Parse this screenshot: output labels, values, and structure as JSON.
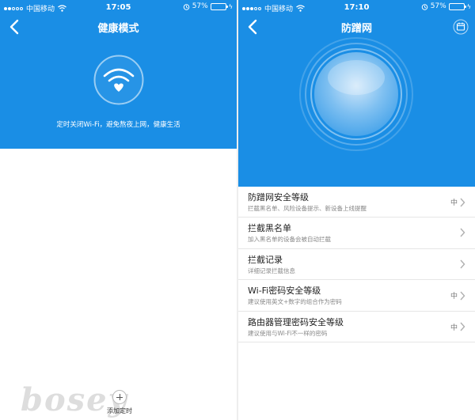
{
  "left": {
    "status": {
      "carrier": "中国移动",
      "time": "17:05",
      "battery": "57%"
    },
    "title": "健康模式",
    "description": "定时关闭Wi-Fi，避免熬夜上网，健康生活",
    "add_timer_label": "添加定时",
    "watermark": "bosey"
  },
  "right": {
    "status": {
      "carrier": "中国移动",
      "time": "17:10",
      "battery": "57%"
    },
    "title": "防蹭网",
    "items": [
      {
        "title": "防蹭网安全等级",
        "subtitle": "拦截黑名单、风险设备提示、新设备上线提醒",
        "value": "中"
      },
      {
        "title": "拦截黑名单",
        "subtitle": "加入黑名单的设备会被自动拦截",
        "value": ""
      },
      {
        "title": "拦截记录",
        "subtitle": "详细记录拦截信息",
        "value": ""
      },
      {
        "title": "Wi-Fi密码安全等级",
        "subtitle": "建议使用英文+数字的组合作为密码",
        "value": "中"
      },
      {
        "title": "路由器管理密码安全等级",
        "subtitle": "建议使用与Wi-Fi不一样的密码",
        "value": "中"
      }
    ]
  },
  "colors": {
    "primary_blue": "#1a8ee5",
    "battery_green": "#4cd964"
  },
  "icons": [
    "signal-dots-icon",
    "wifi-status-icon",
    "alarm-icon",
    "battery-icon",
    "back-arrow-icon",
    "wifi-heart-icon",
    "plus-icon",
    "calendar-icon",
    "chevron-right-icon"
  ]
}
